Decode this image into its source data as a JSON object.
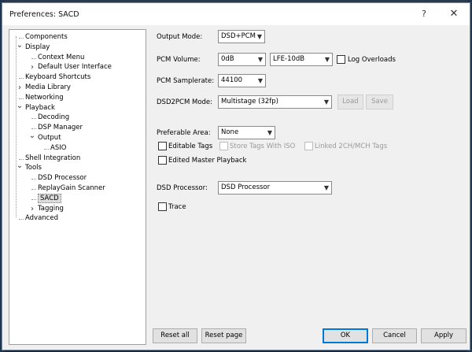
{
  "window": {
    "title": "Preferences: SACD",
    "help_glyph": "?",
    "close_glyph": "✕"
  },
  "tree": {
    "items": [
      {
        "label": "Components",
        "level": 0,
        "expander": ""
      },
      {
        "label": "Display",
        "level": 0,
        "expander": "v"
      },
      {
        "label": "Context Menu",
        "level": 1,
        "expander": ""
      },
      {
        "label": "Default User Interface",
        "level": 1,
        "expander": ">"
      },
      {
        "label": "Keyboard Shortcuts",
        "level": 0,
        "expander": ""
      },
      {
        "label": "Media Library",
        "level": 0,
        "expander": ">"
      },
      {
        "label": "Networking",
        "level": 0,
        "expander": ""
      },
      {
        "label": "Playback",
        "level": 0,
        "expander": "v"
      },
      {
        "label": "Decoding",
        "level": 1,
        "expander": ""
      },
      {
        "label": "DSP Manager",
        "level": 1,
        "expander": ""
      },
      {
        "label": "Output",
        "level": 1,
        "expander": "v"
      },
      {
        "label": "ASIO",
        "level": 2,
        "expander": ""
      },
      {
        "label": "Shell Integration",
        "level": 0,
        "expander": ""
      },
      {
        "label": "Tools",
        "level": 0,
        "expander": "v"
      },
      {
        "label": "DSD Processor",
        "level": 1,
        "expander": ""
      },
      {
        "label": "ReplayGain Scanner",
        "level": 1,
        "expander": ""
      },
      {
        "label": "SACD",
        "level": 1,
        "expander": "",
        "selected": true
      },
      {
        "label": "Tagging",
        "level": 1,
        "expander": ">"
      },
      {
        "label": "Advanced",
        "level": 0,
        "expander": ""
      }
    ]
  },
  "settings": {
    "output_mode": {
      "label": "Output Mode:",
      "value": "DSD+PCM"
    },
    "pcm_volume": {
      "label": "PCM Volume:",
      "value": "0dB",
      "lfe_value": "LFE-10dB",
      "log_overloads": "Log Overloads"
    },
    "pcm_samplerate": {
      "label": "PCM Samplerate:",
      "value": "44100"
    },
    "dsd2pcm_mode": {
      "label": "DSD2PCM Mode:",
      "value": "Multistage (32fp)",
      "load": "Load",
      "save": "Save"
    },
    "preferable_area": {
      "label": "Preferable Area:",
      "value": "None"
    },
    "editable_tags": "Editable Tags",
    "store_tags_iso": "Store Tags With ISO",
    "linked_2ch_mch": "Linked 2CH/MCH Tags",
    "edited_master": "Edited Master Playback",
    "dsd_processor": {
      "label": "DSD Processor:",
      "value": "DSD Processor"
    },
    "trace": "Trace"
  },
  "buttons": {
    "reset_all": "Reset all",
    "reset_page": "Reset page",
    "ok": "OK",
    "cancel": "Cancel",
    "apply": "Apply"
  }
}
